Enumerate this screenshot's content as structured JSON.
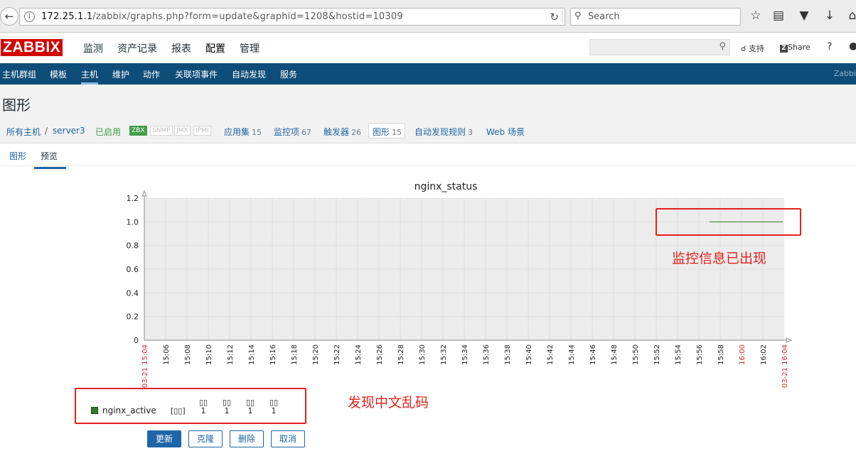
{
  "browser": {
    "url_host": "172.25.1.1",
    "url_path": "/zabbix/graphs.php?form=update&graphid=1208&hostid=10309",
    "search_placeholder": "Search"
  },
  "header": {
    "logo": "ZABBIX",
    "nav": [
      "监测",
      "资产记录",
      "报表",
      "配置",
      "管理"
    ],
    "support": "支持",
    "share": "Share",
    "help": "?"
  },
  "subnav": {
    "items": [
      "主机群组",
      "模板",
      "主机",
      "维护",
      "动作",
      "关联项事件",
      "自动发现",
      "服务"
    ],
    "active": "主机",
    "brand": "Zabbi"
  },
  "page": {
    "title": "图形"
  },
  "hostbar": {
    "all_hosts": "所有主机",
    "separator": "/",
    "host": "server3",
    "status": "已启用",
    "protocols": [
      "ZBX",
      "SNMP",
      "JMX",
      "IPMI"
    ],
    "links": [
      {
        "label": "应用集",
        "count": "15"
      },
      {
        "label": "监控项",
        "count": "67"
      },
      {
        "label": "触发器",
        "count": "26"
      },
      {
        "label": "图形",
        "count": "15"
      },
      {
        "label": "自动发现规则",
        "count": "3"
      },
      {
        "label": "Web 场景",
        "count": ""
      }
    ]
  },
  "tabs": [
    "图形",
    "预览"
  ],
  "chart_data": {
    "type": "line",
    "title": "nginx_status",
    "ylim": [
      0,
      1.2
    ],
    "y_ticks": [
      "0",
      "0.2",
      "0.4",
      "0.6",
      "0.8",
      "1.0",
      "1.2"
    ],
    "x_start_label": "03-21 15:04",
    "x_end_label": "03-21 16:04",
    "x_ticks": [
      "15:06",
      "15:08",
      "15:10",
      "15:12",
      "15:14",
      "15:16",
      "15:18",
      "15:20",
      "15:22",
      "15:24",
      "15:26",
      "15:28",
      "15:30",
      "15:32",
      "15:34",
      "15:36",
      "15:38",
      "15:40",
      "15:42",
      "15:44",
      "15:46",
      "15:48",
      "15:50",
      "15:52",
      "15:54",
      "15:56",
      "15:58",
      "16:00",
      "16:02"
    ],
    "highlight_ticks": [
      "16:00"
    ],
    "series": [
      {
        "name": "nginx_active",
        "color": "#2f7d25",
        "x_from": "15:57",
        "x_to": "16:04",
        "value": 1
      }
    ],
    "grid": true
  },
  "legend": {
    "name": "nginx_active",
    "garbled_func": "[▯▯]",
    "garbled_headers": [
      "▯▯",
      "▯▯",
      "▯▯",
      "▯▯"
    ],
    "values": [
      "1",
      "1",
      "1",
      "1"
    ]
  },
  "annotations": {
    "top": "监控信息已出现",
    "bottom": "发现中文乱码"
  },
  "buttons": [
    "更新",
    "克隆",
    "删除",
    "取消"
  ],
  "colors": {
    "accent": "#1f65a6",
    "nav_bg": "#0e4d78",
    "annotation": "#e5211c",
    "series": "#2f7d25"
  }
}
